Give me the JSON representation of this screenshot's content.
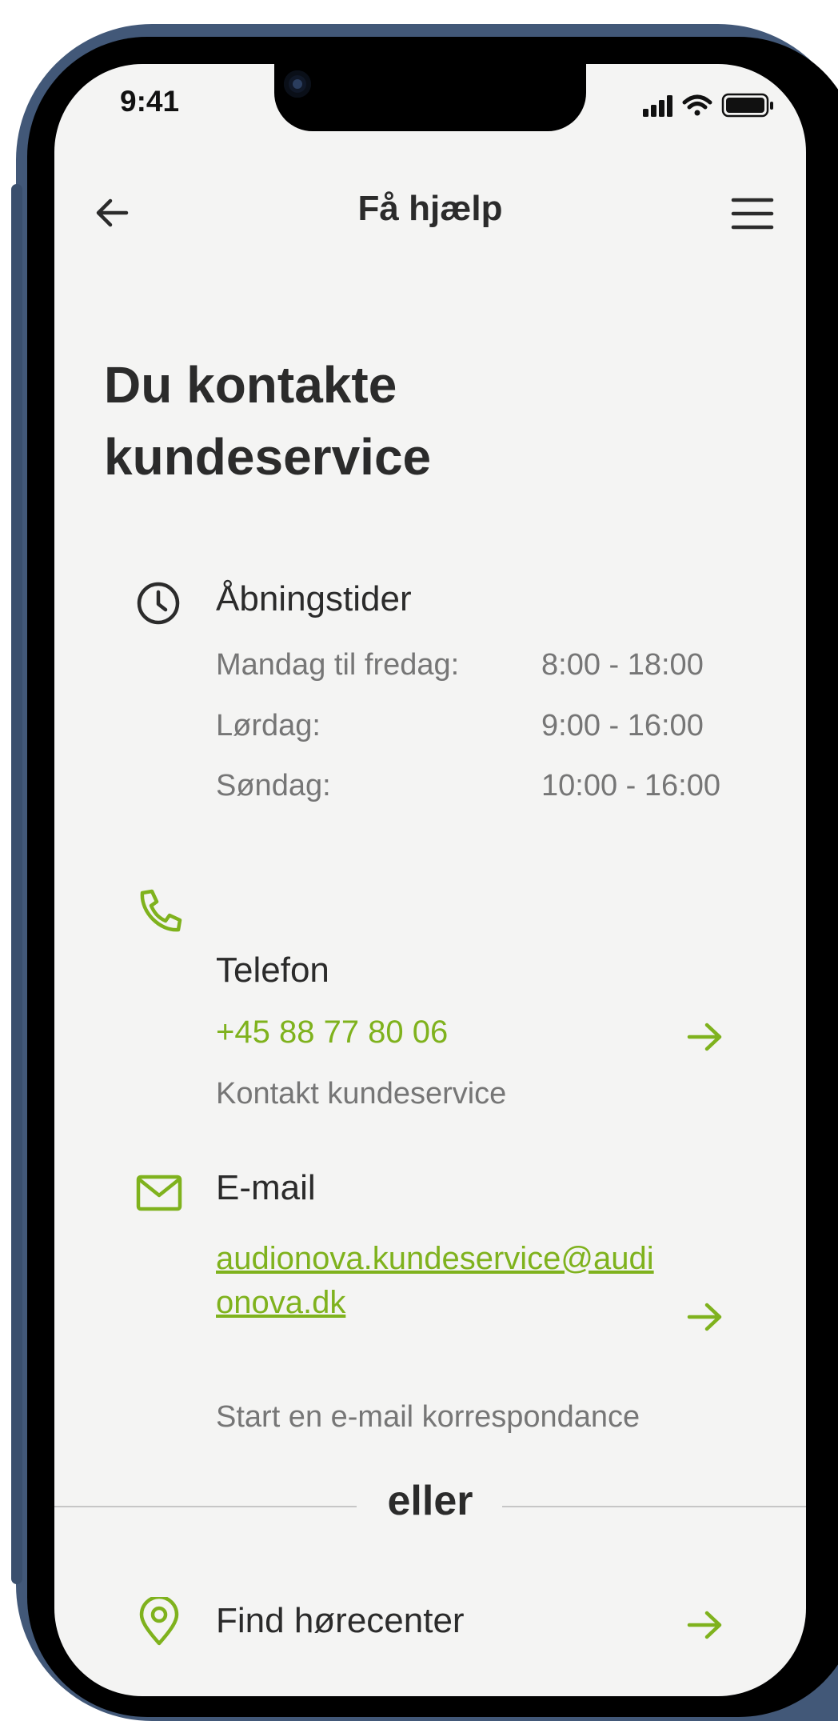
{
  "status_bar": {
    "time": "9:41"
  },
  "header": {
    "title": "Få hjælp"
  },
  "page_title": "Du kontakte kundeservice",
  "opening_hours": {
    "heading": "Åbningstider",
    "rows": [
      {
        "day": "Mandag til fredag:",
        "hours": "8:00 - 18:00"
      },
      {
        "day": "Lørdag:",
        "hours": "9:00 - 16:00"
      },
      {
        "day": "Søndag:",
        "hours": "10:00 - 16:00"
      }
    ]
  },
  "phone": {
    "heading": "Telefon",
    "number": "+45 88 77 80 06",
    "description": "Kontakt kundeservice"
  },
  "email": {
    "heading": "E-mail",
    "address": "audionova.kundeservice@audionova.dk",
    "description": "Start en e-mail korrespondance"
  },
  "divider_label": "eller",
  "find_center": {
    "label": "Find hørecenter"
  },
  "colors": {
    "accent": "#7fb21d",
    "text": "#2b2b2b",
    "muted": "#767676",
    "background": "#f4f4f3"
  },
  "icons": [
    "back-arrow-icon",
    "hamburger-menu-icon",
    "clock-icon",
    "phone-icon",
    "mail-icon",
    "location-pin-icon",
    "arrow-right-icon",
    "signal-icon",
    "wifi-icon",
    "battery-icon"
  ]
}
